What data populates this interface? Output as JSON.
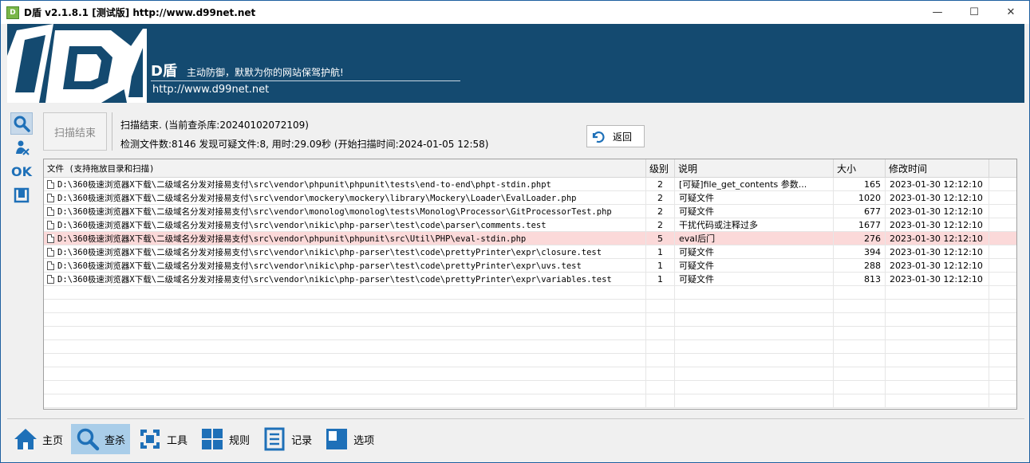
{
  "window": {
    "title": "D盾 v2.1.8.1 [测试版] http://www.d99net.net",
    "app_icon_text": "D盾",
    "minimize": "—",
    "maximize": "☐",
    "close": "✕"
  },
  "banner": {
    "brand": "D盾",
    "slogan": "主动防御，默默为你的网站保驾护航!",
    "url": "http://www.d99net.net"
  },
  "left_tools": {
    "ok_label": "OK"
  },
  "scan": {
    "button_label": "扫描结束",
    "status_line1": "扫描结束. (当前查杀库:20240102072109)",
    "status_line2": "检测文件数:8146 发现可疑文件:8, 用时:29.09秒 (开始扫描时间:2024-01-05 12:58)",
    "back_label": "返回"
  },
  "table": {
    "headers": [
      "文件 (支持拖放目录和扫描)",
      "级别",
      "说明",
      "大小",
      "修改时间"
    ],
    "rows": [
      {
        "file": "D:\\360极速浏览器X下载\\二级域名分发对接易支付\\src\\vendor\\phpunit\\phpunit\\tests\\end-to-end\\phpt-stdin.phpt",
        "level": "2",
        "desc": "[可疑]file_get_contents 参数...",
        "size": "165",
        "time": "2023-01-30 12:12:10"
      },
      {
        "file": "D:\\360极速浏览器X下载\\二级域名分发对接易支付\\src\\vendor\\mockery\\mockery\\library\\Mockery\\Loader\\EvalLoader.php",
        "level": "2",
        "desc": "可疑文件",
        "size": "1020",
        "time": "2023-01-30 12:12:10"
      },
      {
        "file": "D:\\360极速浏览器X下载\\二级域名分发对接易支付\\src\\vendor\\monolog\\monolog\\tests\\Monolog\\Processor\\GitProcessorTest.php",
        "level": "2",
        "desc": "可疑文件",
        "size": "677",
        "time": "2023-01-30 12:12:10"
      },
      {
        "file": "D:\\360极速浏览器X下载\\二级域名分发对接易支付\\src\\vendor\\nikic\\php-parser\\test\\code\\parser\\comments.test",
        "level": "2",
        "desc": "干扰代码或注释过多",
        "size": "1677",
        "time": "2023-01-30 12:12:10"
      },
      {
        "file": "D:\\360极速浏览器X下载\\二级域名分发对接易支付\\src\\vendor\\phpunit\\phpunit\\src\\Util\\PHP\\eval-stdin.php",
        "level": "5",
        "desc": "eval后门",
        "size": "276",
        "time": "2023-01-30 12:12:10"
      },
      {
        "file": "D:\\360极速浏览器X下载\\二级域名分发对接易支付\\src\\vendor\\nikic\\php-parser\\test\\code\\prettyPrinter\\expr\\closure.test",
        "level": "1",
        "desc": "可疑文件",
        "size": "394",
        "time": "2023-01-30 12:12:10"
      },
      {
        "file": "D:\\360极速浏览器X下载\\二级域名分发对接易支付\\src\\vendor\\nikic\\php-parser\\test\\code\\prettyPrinter\\expr\\uvs.test",
        "level": "1",
        "desc": "可疑文件",
        "size": "288",
        "time": "2023-01-30 12:12:10"
      },
      {
        "file": "D:\\360极速浏览器X下载\\二级域名分发对接易支付\\src\\vendor\\nikic\\php-parser\\test\\code\\prettyPrinter\\expr\\variables.test",
        "level": "1",
        "desc": "可疑文件",
        "size": "813",
        "time": "2023-01-30 12:12:10"
      }
    ],
    "selected_row": 4
  },
  "bottom_nav": [
    {
      "label": "主页",
      "icon": "home-icon"
    },
    {
      "label": "查杀",
      "icon": "search-icon"
    },
    {
      "label": "工具",
      "icon": "tools-icon"
    },
    {
      "label": "规则",
      "icon": "grid-icon"
    },
    {
      "label": "记录",
      "icon": "log-icon"
    },
    {
      "label": "选项",
      "icon": "options-icon"
    }
  ],
  "colors": {
    "banner_bg": "#144a70",
    "accent": "#1e70b8",
    "selected_row": "#fbd9d9",
    "active_nav": "#a9cde9"
  }
}
